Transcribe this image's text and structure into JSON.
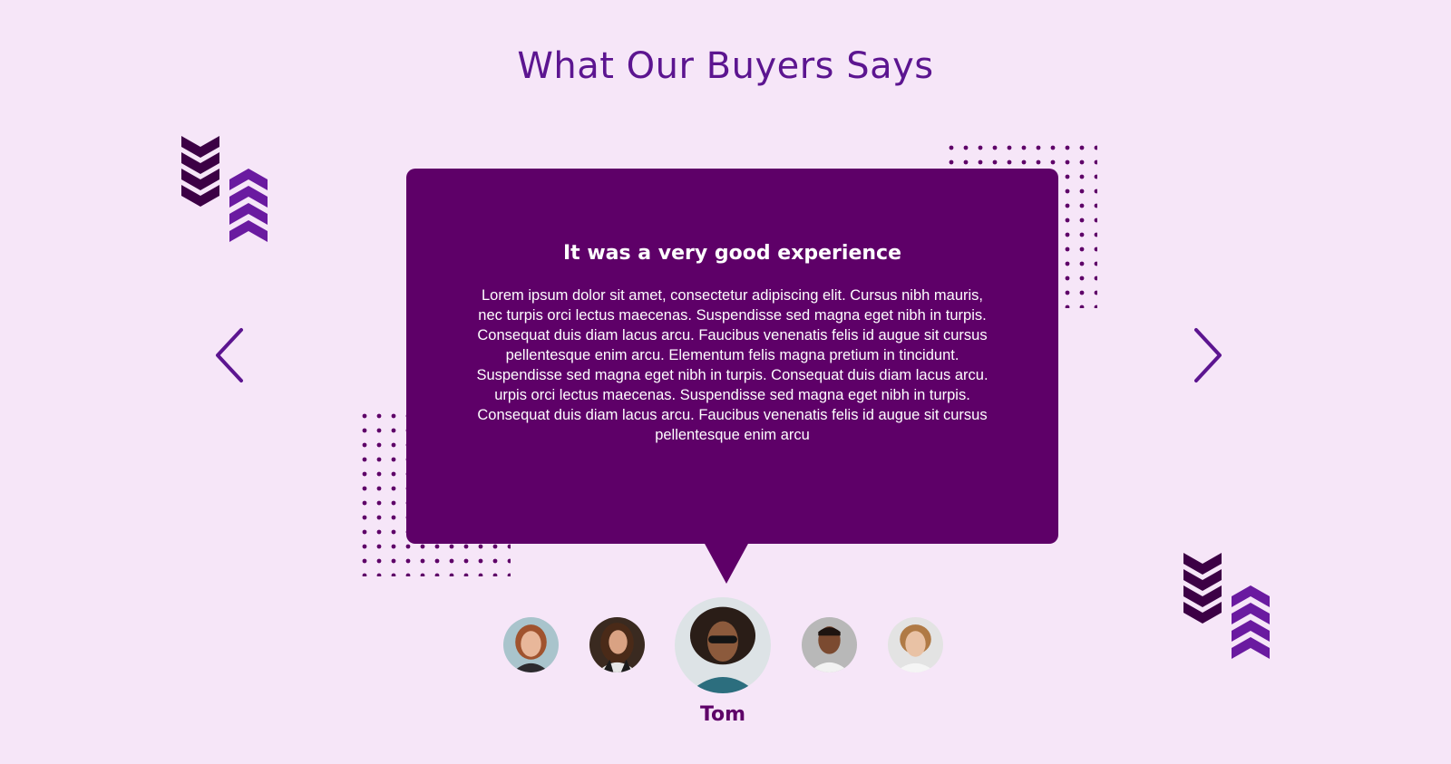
{
  "section": {
    "title": "What Our Buyers Says"
  },
  "testimonial": {
    "heading": "It was a very good experience",
    "body": "Lorem ipsum dolor sit amet, consectetur adipiscing elit. Cursus nibh mauris, nec turpis orci lectus maecenas. Suspendisse sed magna eget nibh in turpis. Consequat duis diam lacus arcu. Faucibus venenatis felis id augue sit cursus pellentesque enim arcu. Elementum felis magna pretium in tincidunt. Suspendisse sed magna eget nibh in turpis. Consequat duis diam lacus arcu. urpis orci lectus maecenas. Suspendisse sed magna eget nibh in turpis. Consequat duis diam lacus arcu. Faucibus venenatis felis id augue sit cursus pellentesque enim arcu"
  },
  "reviewers": {
    "active_name": "Tom",
    "active_index": 2,
    "count": 5
  },
  "navigation": {
    "prev_icon": "chevron-left-icon",
    "next_icon": "chevron-right-icon"
  },
  "colors": {
    "background": "#f6e6f8",
    "card": "#5e0068",
    "title": "#5c1590",
    "chevron_dark": "#3c0045",
    "chevron_light": "#6a1aa0",
    "dots": "#5e0068"
  }
}
